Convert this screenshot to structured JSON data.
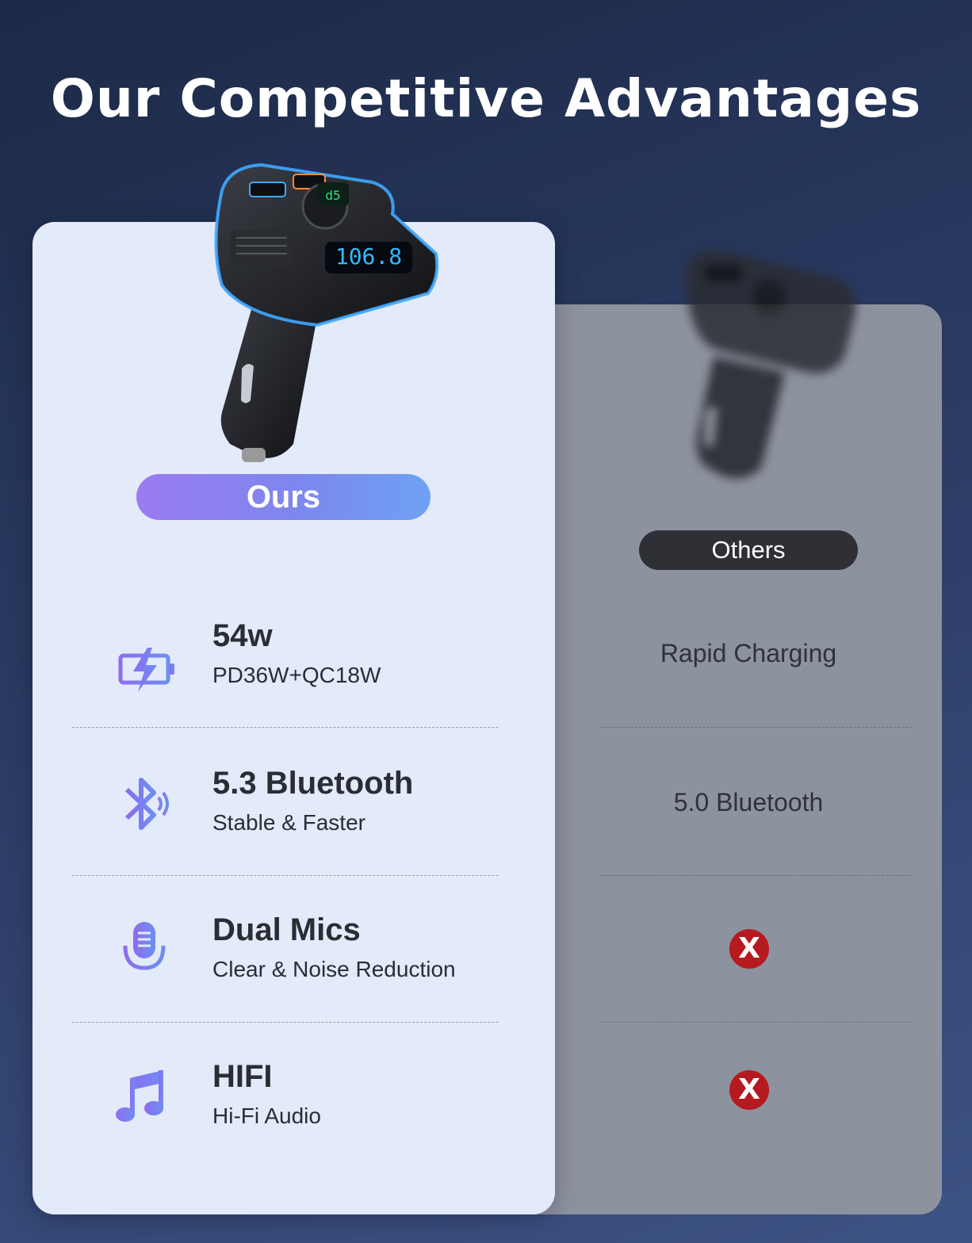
{
  "title": "Our Competitive Advantages",
  "ours": {
    "label": "Ours",
    "features": [
      {
        "icon": "battery-bolt-icon",
        "main": "54w",
        "sub": "PD36W+QC18W"
      },
      {
        "icon": "bluetooth-icon",
        "main": "5.3 Bluetooth",
        "sub": "Stable & Faster"
      },
      {
        "icon": "microphone-icon",
        "main": "Dual Mics",
        "sub": "Clear & Noise Reduction"
      },
      {
        "icon": "music-note-icon",
        "main": "HIFI",
        "sub": "Hi-Fi Audio"
      }
    ]
  },
  "others": {
    "label": "Others",
    "rows": [
      "Rapid Charging",
      "5.0 Bluetooth",
      "X",
      "X"
    ]
  },
  "colors": {
    "accent_purple": "#7d87ee",
    "x_mark": "#b51a1e",
    "others_card": "#8d929f",
    "ours_card": "#e3eafa"
  }
}
